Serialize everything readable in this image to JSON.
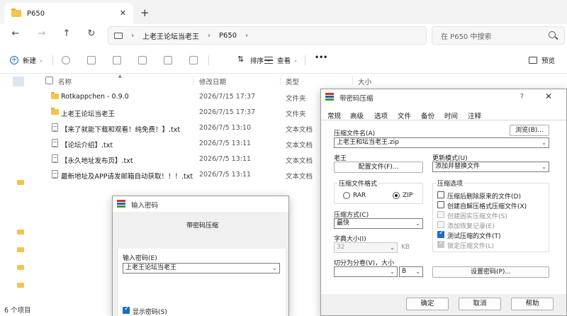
{
  "tab": {
    "title": "P650"
  },
  "nav": {
    "breadcrumb": [
      "上老王论坛当老王",
      "P650"
    ],
    "search_placeholder": "在 P650 中搜索"
  },
  "toolbar": {
    "new_label": "新建",
    "sort_label": "排序",
    "view_label": "查看",
    "more_label": "•••",
    "preview_label": "预览"
  },
  "columns": {
    "name": "名称",
    "date": "修改日期",
    "type": "类型",
    "size": "大小"
  },
  "files": [
    {
      "kind": "folder",
      "name": "Rotkappchen - 0.9.0",
      "date": "2026/7/15 17:37",
      "type": "文件夹"
    },
    {
      "kind": "folder",
      "name": "上老王论坛当老王",
      "date": "2026/7/15 17:37",
      "type": "文件夹"
    },
    {
      "kind": "txt",
      "name": "【来了就能下载和观看！纯免费！】.txt",
      "date": "2026/7/5 13:10",
      "type": "文本文档"
    },
    {
      "kind": "txt",
      "name": "【论坛介绍】.txt",
      "date": "2026/7/5 13:11",
      "type": "文本文档"
    },
    {
      "kind": "txt",
      "name": "【永久地址发布页】.txt",
      "date": "2026/7/5 13:11",
      "type": "文本文档"
    },
    {
      "kind": "txt",
      "name": "最新地址及APP请发邮箱自动获取！！！.txt",
      "date": "2026/7/5 13:11",
      "type": "文本文档"
    }
  ],
  "status": {
    "count": "6 个项目"
  },
  "rar_dialog": {
    "title": "带密码压缩",
    "help": "?",
    "close": "✕",
    "tabs": [
      "常规",
      "高级",
      "选项",
      "文件",
      "备份",
      "时间",
      "注释"
    ],
    "archive_name_label": "压缩文件名(A)",
    "browse_label": "浏览(B)...",
    "archive_name_value": "上老王和坛当老王.zip",
    "profile_label": "老王",
    "profile_button": "配置文件(F)...",
    "update_mode_label": "更新模式(U)",
    "update_mode_value": "添加并替换文件",
    "format_group": "压缩文件格式",
    "format_rar": "RAR",
    "format_zip": "ZIP",
    "method_label": "压缩方式(C)",
    "method_value": "最快",
    "dict_label": "字典大小(I)",
    "dict_value": "32",
    "dict_unit": "KB",
    "split_label": "切分为分卷(V)，大小",
    "split_unit": "B",
    "options_group": "压缩选项",
    "options": [
      {
        "label": "压缩后删除原来的文件(D)",
        "state": "off"
      },
      {
        "label": "创建自解压格式压缩文件(X)",
        "state": "off"
      },
      {
        "label": "创建固实压缩文件(S)",
        "state": "disabled"
      },
      {
        "label": "添加恢复记录(E)",
        "state": "disabled"
      },
      {
        "label": "测试压缩的文件(T)",
        "state": "on"
      },
      {
        "label": "锁定压缩文件(L)",
        "state": "disabled"
      }
    ],
    "set_password_button": "设置密码(P)...",
    "ok_button": "确定",
    "cancel_button": "取消",
    "help_button": "帮助"
  },
  "pwd_dialog": {
    "title": "输入密码",
    "subtitle": "带密码压缩",
    "input_label": "输入密码(E)",
    "input_value": "上老王论坛当老王",
    "show_password_label": "显示密码(S)"
  },
  "colors": {
    "accent": "#1a6ec4",
    "folder": "#f6c34d",
    "rar_red": "#c0392b",
    "rar_blue": "#2c5fb0",
    "rar_green": "#3e9a3b"
  }
}
